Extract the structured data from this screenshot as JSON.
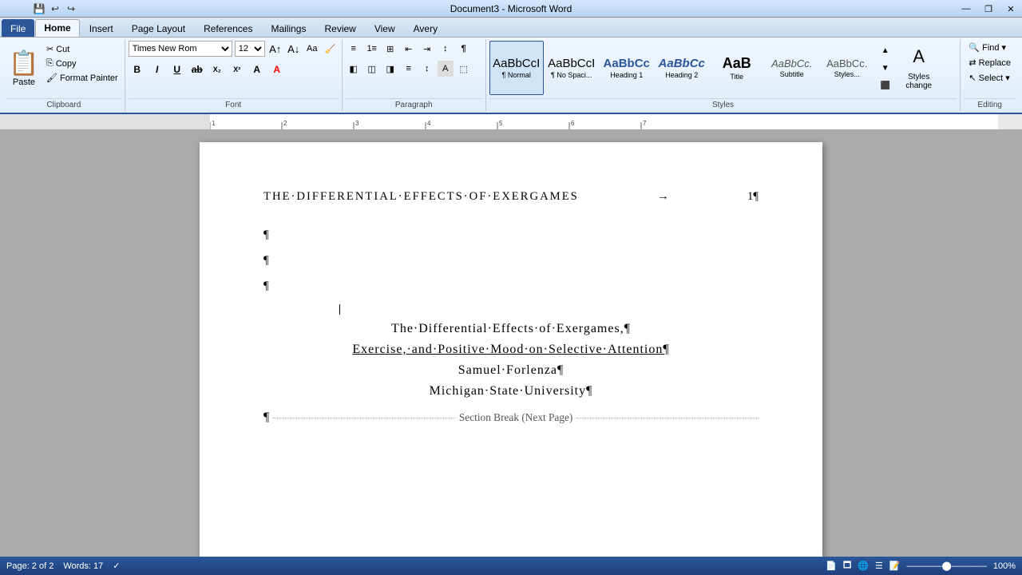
{
  "titlebar": {
    "title": "Document3 - Microsoft Word",
    "minimize": "—",
    "restore": "❐",
    "close": "✕"
  },
  "tabs": [
    {
      "label": "File",
      "active": false,
      "file": true
    },
    {
      "label": "Home",
      "active": true
    },
    {
      "label": "Insert",
      "active": false
    },
    {
      "label": "Page Layout",
      "active": false
    },
    {
      "label": "References",
      "active": false
    },
    {
      "label": "Mailings",
      "active": false
    },
    {
      "label": "Review",
      "active": false
    },
    {
      "label": "View",
      "active": false
    },
    {
      "label": "Avery",
      "active": false
    }
  ],
  "clipboard": {
    "paste_label": "Paste",
    "cut_label": "Cut",
    "copy_label": "Copy",
    "format_painter_label": "Format Painter",
    "group_label": "Clipboard"
  },
  "font_group": {
    "font_name": "Times New Rom",
    "font_size": "12",
    "group_label": "Font"
  },
  "paragraph_group": {
    "group_label": "Paragraph"
  },
  "styles_group": {
    "group_label": "Styles",
    "styles": [
      {
        "label": "¶ Normal",
        "sub": "Normal",
        "active": true
      },
      {
        "label": "¶ No Spaci...",
        "sub": "No Spacing",
        "active": false
      },
      {
        "label": "Heading 1",
        "sub": "Heading 1",
        "active": false
      },
      {
        "label": "Heading 2",
        "sub": "Heading 2",
        "active": false
      },
      {
        "label": "Title",
        "sub": "Title",
        "active": false
      },
      {
        "label": "Subtitle",
        "sub": "Subtitle",
        "active": false
      },
      {
        "label": "AaBbCc.",
        "sub": "Styles...",
        "active": false
      }
    ],
    "change_styles": "Styles change"
  },
  "editing_group": {
    "find_label": "Find",
    "replace_label": "Replace",
    "select_label": "Select",
    "group_label": "Editing"
  },
  "document": {
    "header_text": "THE·DIFFERENTIAL·EFFECTS·OF·EXERGAMES",
    "page_number": "1¶",
    "para_marks": [
      "¶",
      "¶",
      "¶"
    ],
    "title_line": "The·Differential·Effects·of·Exergames,¶",
    "subtitle_line": "Exercise,·and·Positive·Mood·on·Selective·Attention¶",
    "author_line": "Samuel·Forlenza¶",
    "institution_line": "Michigan·State·University¶",
    "section_break": "Section Break (Next Page)"
  },
  "statusbar": {
    "page_info": "Page: 2 of 2",
    "words_info": "Words: 17",
    "zoom": "100%"
  }
}
